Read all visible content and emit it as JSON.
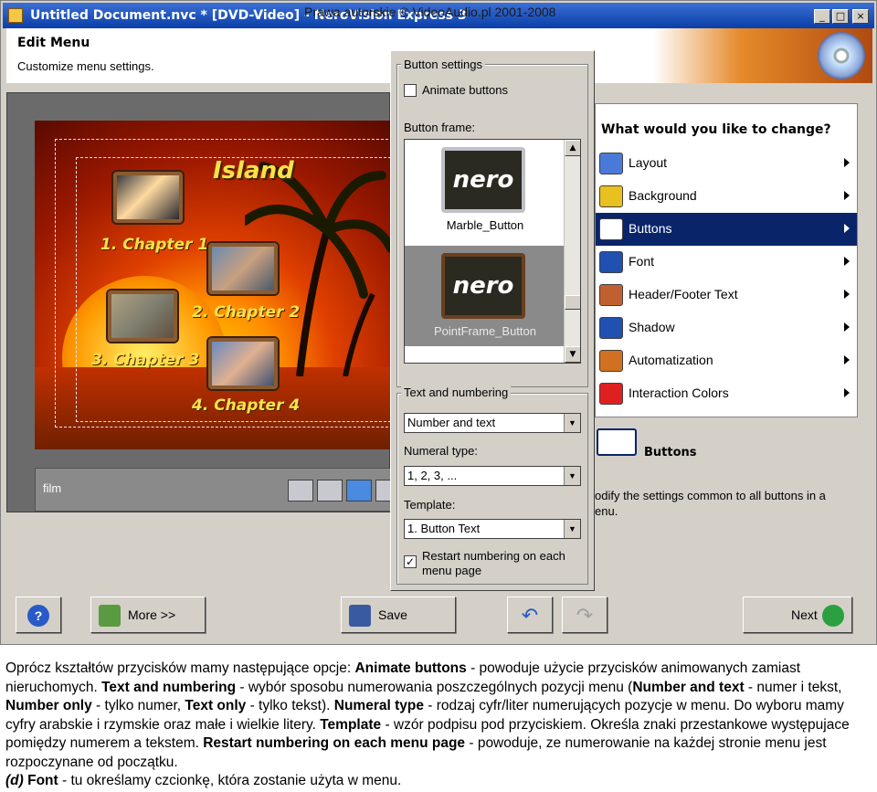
{
  "window": {
    "title": "Untitled Document.nvc * [DVD-Video] - NeroVision Express 3",
    "watermark": "Prawa autorskie © VideoAudio.pl 2001-2008",
    "minimize": "_",
    "maximize": "□",
    "close": "×"
  },
  "header": {
    "title": "Edit Menu",
    "subtitle": "Customize menu settings."
  },
  "preview": {
    "menu_title": "Island",
    "chapters": [
      "1. Chapter 1",
      "2. Chapter 2",
      "3. Chapter 3",
      "4. Chapter 4"
    ],
    "film_label": "film"
  },
  "button_settings": {
    "group_label": "Button settings",
    "animate_label": "Animate buttons",
    "animate_checked": "",
    "frame_label": "Button frame:",
    "frames": [
      {
        "name": "Marble_Button",
        "logo": "nero"
      },
      {
        "name": "PointFrame_Button",
        "logo": "nero"
      }
    ]
  },
  "text_numbering": {
    "group_label": "Text and numbering",
    "mode_value": "Number and text",
    "numeral_label": "Numeral type:",
    "numeral_value": "1, 2, 3, ...",
    "template_label": "Template:",
    "template_value": "1. Button Text",
    "restart_label_1": "Restart numbering on each",
    "restart_label_2": "menu page",
    "restart_checked": "✓"
  },
  "changes": {
    "question": "What would you like to change?",
    "options": [
      {
        "label": "Layout",
        "icon": "layout-icon",
        "color": "#4a7ad8"
      },
      {
        "label": "Background",
        "icon": "background-icon",
        "color": "#e8c020"
      },
      {
        "label": "Buttons",
        "icon": "buttons-icon",
        "color": "#ffffff"
      },
      {
        "label": "Font",
        "icon": "font-icon",
        "color": "#2050b0"
      },
      {
        "label": "Header/Footer Text",
        "icon": "header-footer-icon",
        "color": "#c06030"
      },
      {
        "label": "Shadow",
        "icon": "shadow-icon",
        "color": "#2050b0"
      },
      {
        "label": "Automatization",
        "icon": "automatization-icon",
        "color": "#d07020"
      },
      {
        "label": "Interaction Colors",
        "icon": "interaction-colors-icon",
        "color": "#e02020"
      }
    ],
    "active_index": 2,
    "selected_name": "Buttons",
    "description_1": "odify the settings common to all buttons in a",
    "description_2": "enu."
  },
  "bottom": {
    "help": "?",
    "more": "More >>",
    "save": "Save",
    "undo": "↶",
    "redo": "↷",
    "next": "Next"
  },
  "article": {
    "p1_a": "Oprócz kształtów przycisków mamy następujące opcje: ",
    "p1_b": "Animate buttons",
    "p1_c": " - powoduje użycie przycisków animowanych zamiast nieruchomych. ",
    "p1_d": "Text and numbering",
    "p1_e": " - wybór sposobu numerowania poszczególnych pozycji menu (",
    "p1_f": "Number and text",
    "p1_g": " - numer i tekst, ",
    "p1_h": "Number only",
    "p1_i": " - tylko numer, ",
    "p1_j": "Text only",
    "p1_k": " - tylko tekst). ",
    "p1_l": "Numeral type",
    "p1_m": " - rodzaj cyfr/liter numerujących pozycje w menu. Do wyboru mamy cyfry arabskie i rzymskie oraz małe i wielkie litery. ",
    "p1_n": "Template",
    "p1_o": " - wzór podpisu pod przyciskiem. Określa znaki przestankowe występujace pomiędzy numerem a tekstem. ",
    "p1_p": "Restart numbering on each menu page",
    "p1_q": " - powoduje, ze numerowanie na każdej stronie menu jest rozpoczynane od początku.",
    "p2_a": "(d)",
    "p2_b": " Font",
    "p2_c": " - tu określamy czcionkę, która zostanie użyta w menu."
  }
}
